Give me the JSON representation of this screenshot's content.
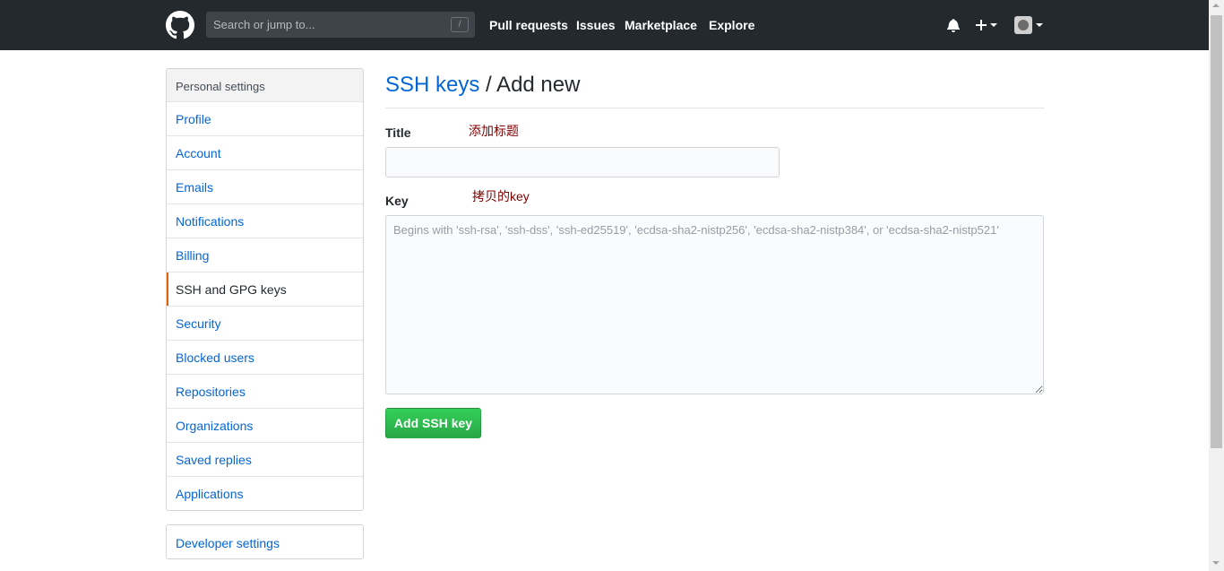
{
  "header": {
    "logo_icon": "github-octocat-icon",
    "search": {
      "placeholder": "Search or jump to...",
      "shortcut": "/"
    },
    "nav": [
      "Pull requests",
      "Issues",
      "Marketplace",
      "Explore"
    ],
    "icons": [
      "bell-icon",
      "plus-icon",
      "avatar-icon"
    ]
  },
  "sidebar": {
    "heading": "Personal settings",
    "items": [
      {
        "label": "Profile"
      },
      {
        "label": "Account"
      },
      {
        "label": "Emails"
      },
      {
        "label": "Notifications"
      },
      {
        "label": "Billing"
      },
      {
        "label": "SSH and GPG keys",
        "selected": true
      },
      {
        "label": "Security"
      },
      {
        "label": "Blocked users"
      },
      {
        "label": "Repositories"
      },
      {
        "label": "Organizations"
      },
      {
        "label": "Saved replies"
      },
      {
        "label": "Applications"
      }
    ],
    "developer": "Developer settings"
  },
  "main": {
    "breadcrumb_link": "SSH keys",
    "breadcrumb_current": "/ Add new",
    "title_label": "Title",
    "title_annotation": "添加标题",
    "title_value": "",
    "key_label": "Key",
    "key_annotation": "拷贝的key",
    "key_placeholder": "Begins with 'ssh-rsa', 'ssh-dss', 'ssh-ed25519', 'ecdsa-sha2-nistp256', 'ecdsa-sha2-nistp384', or 'ecdsa-sha2-nistp521'",
    "submit_label": "Add SSH key"
  },
  "colors": {
    "header_bg": "#24292e",
    "link": "#0366d6",
    "selected_accent": "#e36209",
    "button_green": "#28a745",
    "annotation": "#800000"
  }
}
